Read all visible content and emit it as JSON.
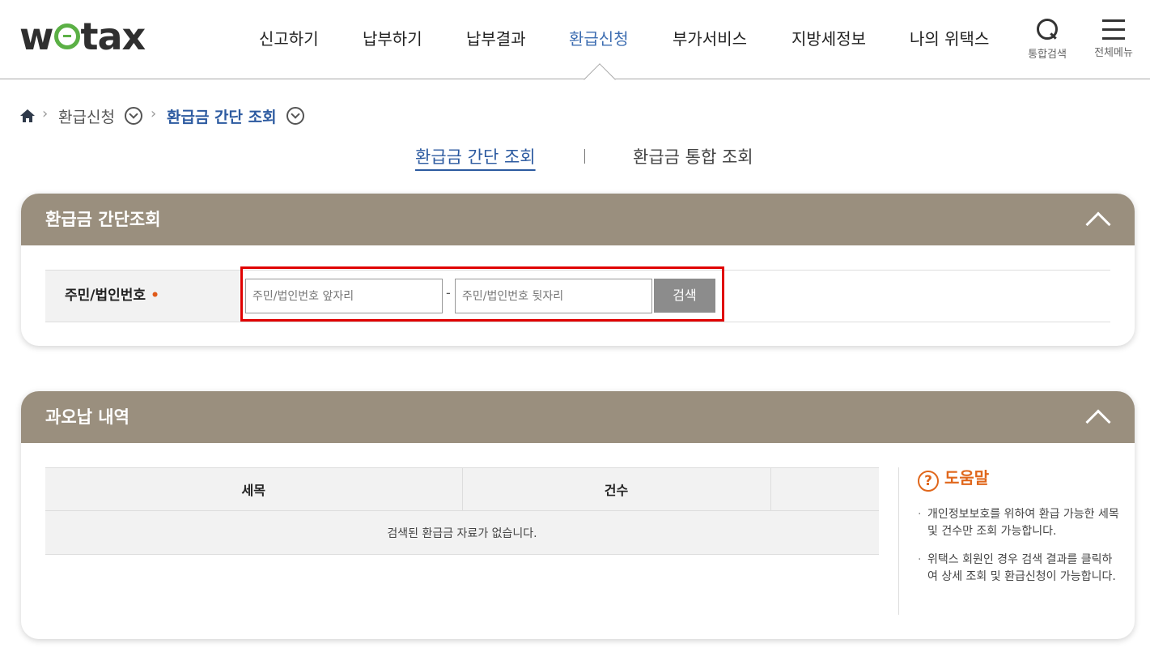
{
  "header": {
    "logo_prefix": "w",
    "logo_suffix": "tax",
    "nav": [
      {
        "label": "신고하기"
      },
      {
        "label": "납부하기"
      },
      {
        "label": "납부결과"
      },
      {
        "label": "환급신청",
        "active": true
      },
      {
        "label": "부가서비스"
      },
      {
        "label": "지방세정보"
      },
      {
        "label": "나의 위택스"
      }
    ],
    "tools": {
      "search_label": "통합검색",
      "menu_label": "전체메뉴"
    }
  },
  "breadcrumb": {
    "level1": "환급신청",
    "level2": "환급금 간단 조회"
  },
  "tabs": [
    {
      "label": "환급금 간단 조회",
      "active": true
    },
    {
      "label": "환급금 통합 조회",
      "active": false
    }
  ],
  "search_panel": {
    "title": "환급금 간단조회",
    "field_label": "주민/법인번호",
    "required_mark": "•",
    "front_placeholder": "주민/법인번호 앞자리",
    "back_placeholder": "주민/법인번호 뒷자리",
    "separator": "-",
    "search_button": "검색"
  },
  "result_panel": {
    "title": "과오납 내역",
    "columns": [
      "세목",
      "건수",
      ""
    ],
    "empty_message": "검색된 환급금 자료가 없습니다."
  },
  "help": {
    "icon": "?",
    "title": "도움말",
    "items": [
      "개인정보보호를 위하여 환급 가능한 세목 및 건수만 조회 가능합니다.",
      "위택스 회원인 경우 검색 결과를 클릭하여 상세 조회 및 환급신청이 가능합니다."
    ]
  },
  "colors": {
    "accent": "#3d6db1",
    "panel_header": "#9a8f7e",
    "highlight": "#e00000",
    "help": "#e0671c"
  }
}
